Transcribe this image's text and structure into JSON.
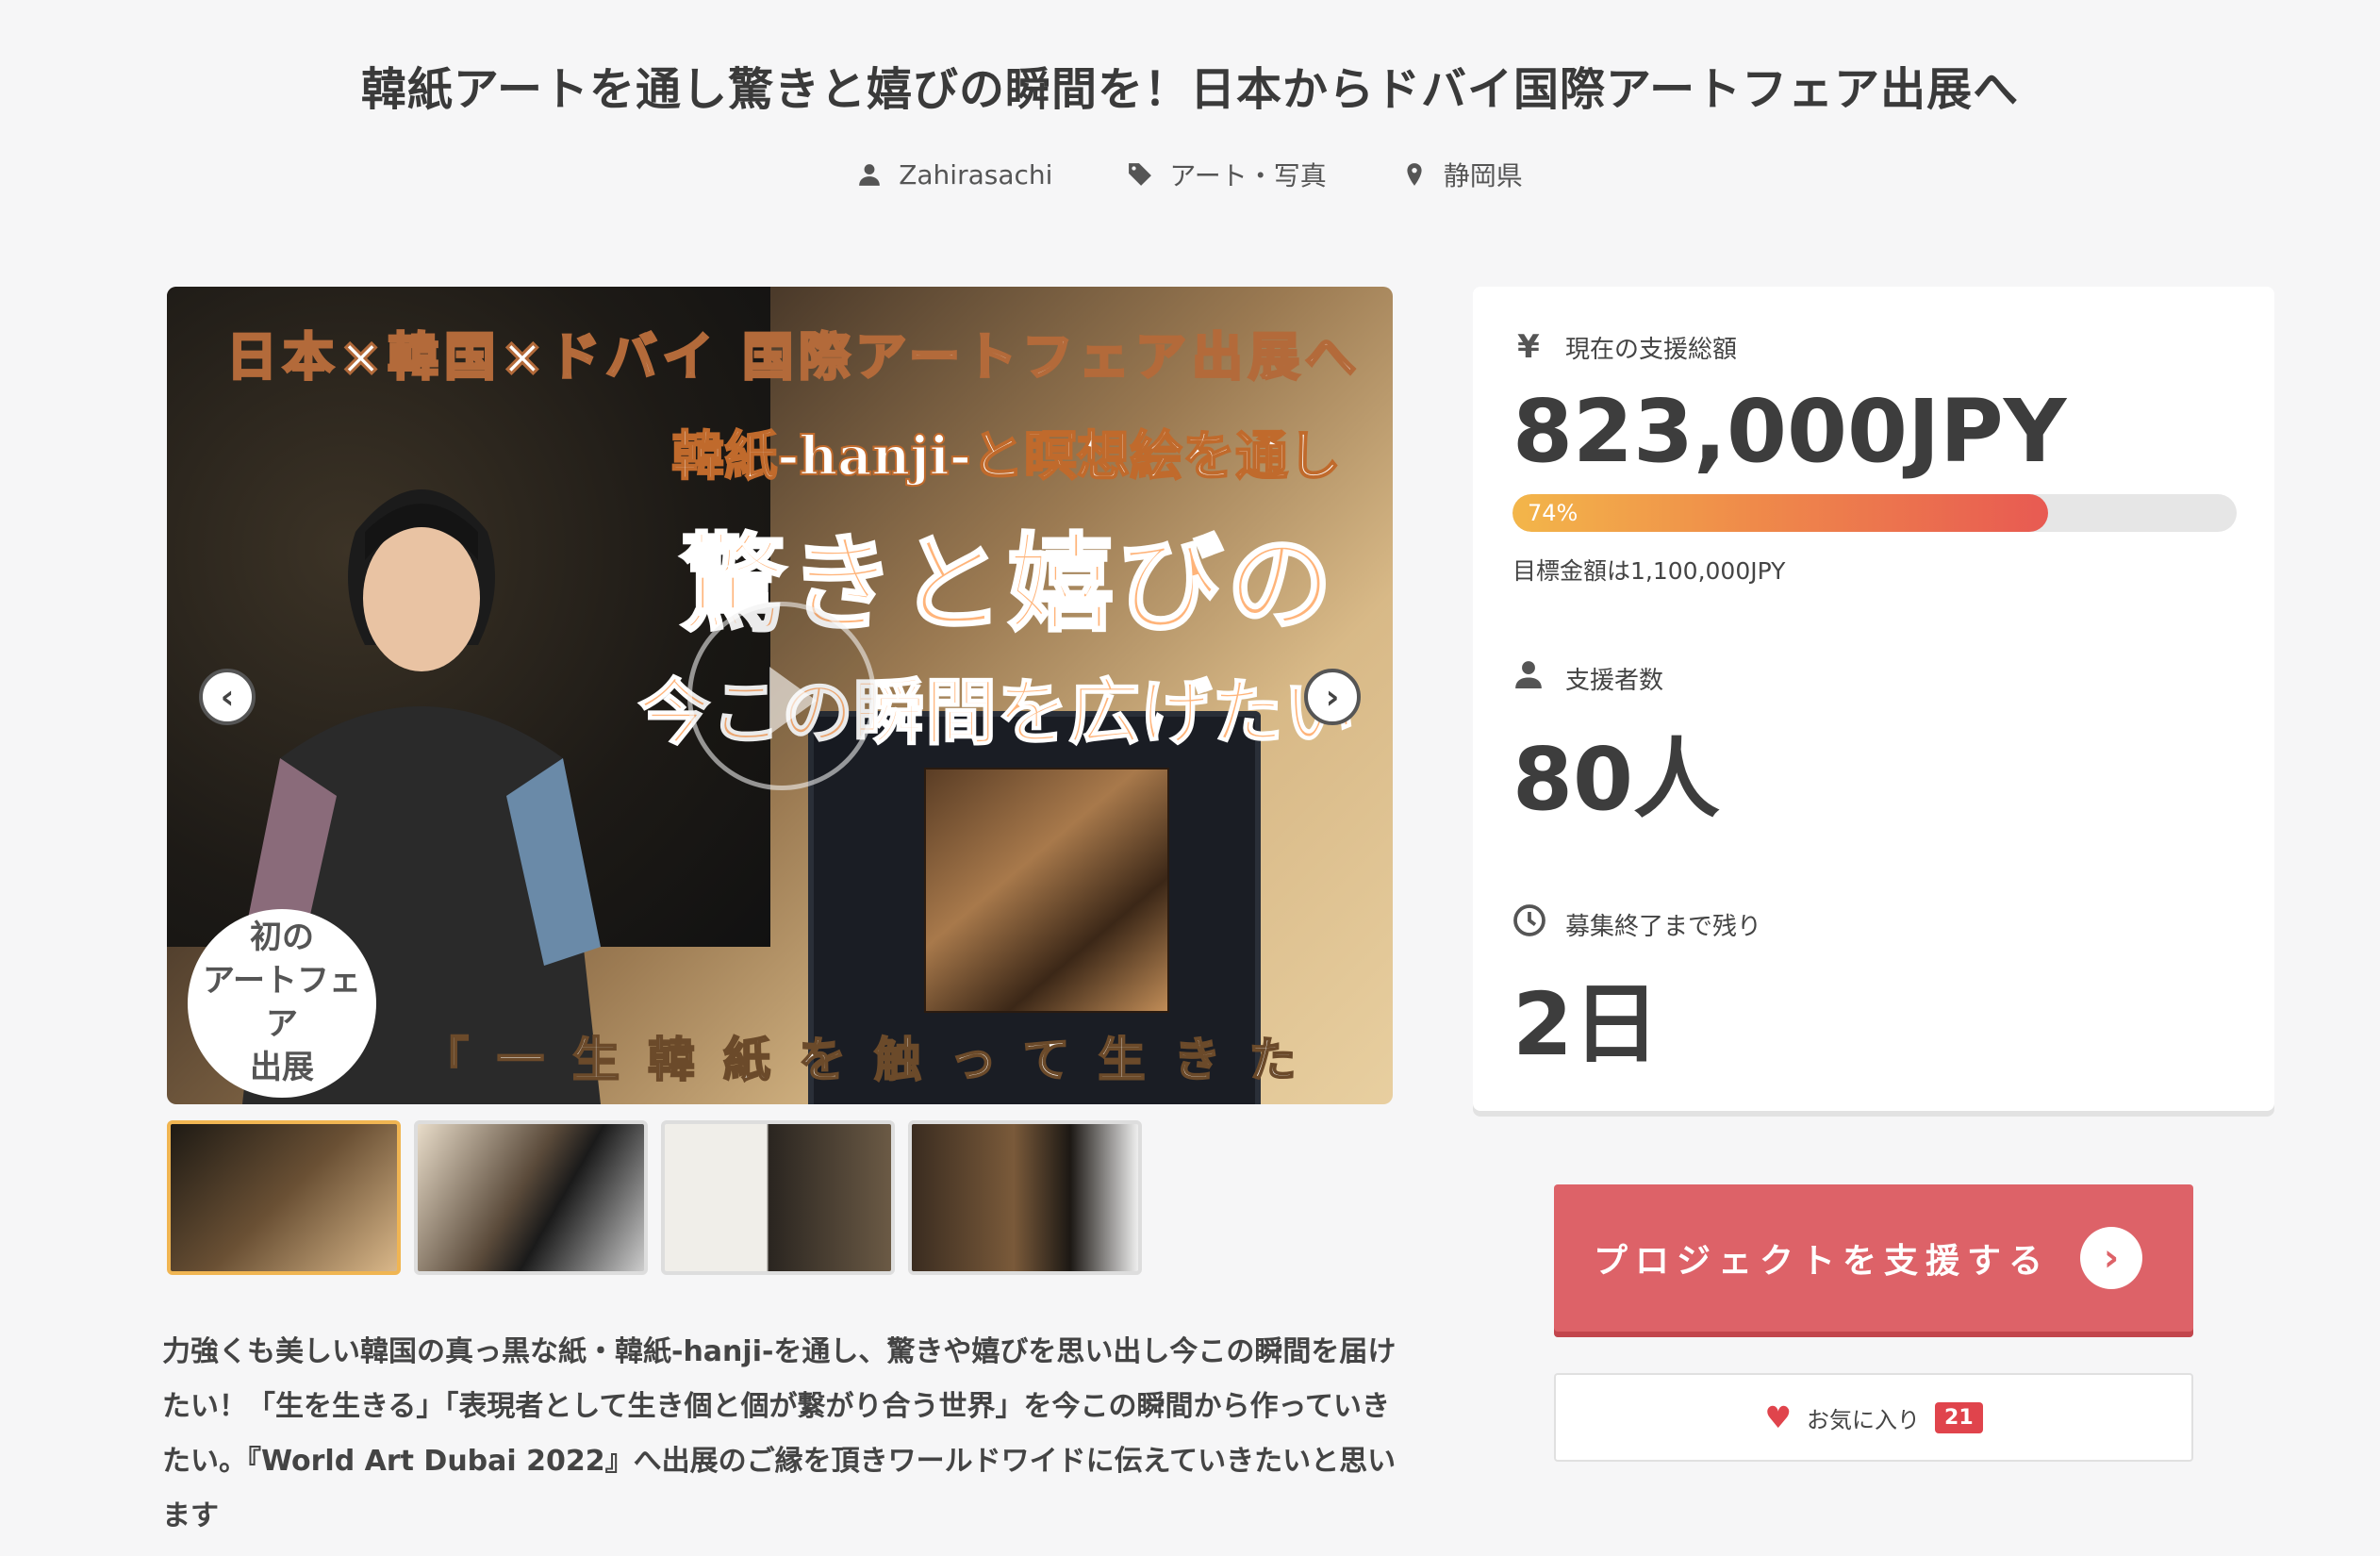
{
  "project": {
    "title": "韓紙アートを通し驚きと嬉びの瞬間を！日本からドバイ国際アートフェア出展へ",
    "owner": "Zahirasachi",
    "category": "アート・写真",
    "location": "静岡県"
  },
  "hero": {
    "top_text": "日本×韓国×ドバイ 国際アートフェア出展へ",
    "sub_text": "韓紙-hanji-と瞑想絵を通し",
    "big_text": "驚きと嬉びの",
    "big_text2": "今この瞬間を広げたい",
    "quote": "「一生韓紙を触って生きたい」",
    "badge": "初の\nアートフェア\n出展",
    "prev_arrow": "‹",
    "next_arrow": "›"
  },
  "thumbnails": [
    {
      "active": true
    },
    {
      "active": false
    },
    {
      "active": false
    },
    {
      "active": false
    }
  ],
  "description": "力強くも美しい韓国の真っ黒な紙・韓紙-hanji-を通し、驚きや嬉びを思い出し今この瞬間を届けたい！「生を生きる」「表現者として生き個と個が繋がり合う世界」を今この瞬間から作っていきたい。『World Art Dubai 2022』へ出展のご縁を頂きワールドワイドに伝えていきたいと思います",
  "stats": {
    "total_label": "現在の支援総額",
    "total_icon": "¥",
    "total_value": "823,000JPY",
    "progress_percent": 74,
    "progress_label": "74%",
    "goal_text": "目標金額は1,100,000JPY",
    "backers_label": "支援者数",
    "backers_value": "80人",
    "remaining_label": "募集終了まで残り",
    "remaining_value": "2日"
  },
  "actions": {
    "support_label": "プロジェクトを支援する",
    "support_arrow": "›",
    "favorite_label": "お気に入り",
    "favorite_count": "21"
  },
  "colors": {
    "accent": "#dd6268",
    "heart": "#e0444c",
    "progress_start": "#f3b64a",
    "progress_end": "#e85a52"
  }
}
